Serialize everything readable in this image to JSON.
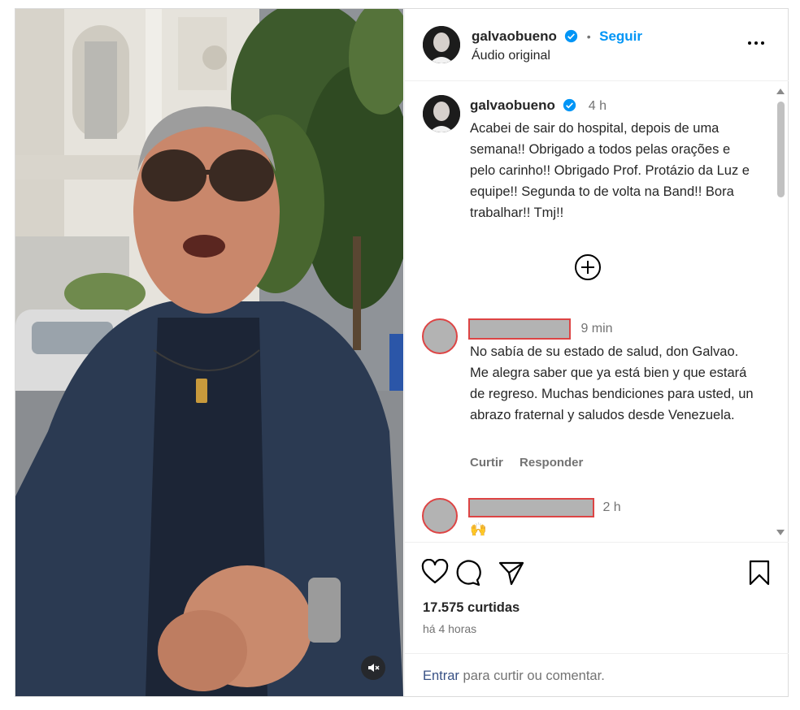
{
  "post": {
    "username": "galvaobueno",
    "follow_label": "Seguir",
    "separator": "•",
    "audio_label": "Áudio original"
  },
  "caption": {
    "username": "galvaobueno",
    "time": "4 h",
    "text": "Acabei de sair do hospital, depois de uma semana!! Obrigado a todos pelas orações e pelo carinho!! Obrigado Prof. Protázio da Luz e equipe!! Segunda to de volta na Band!! Bora trabalhar!! Tmj!!"
  },
  "comments": [
    {
      "time": "9 min",
      "text": "No sabía de su estado de salud, don Galvao. Me alegra saber que ya está bien y que estará de regreso. Muchas bendiciones para usted, un abrazo fraternal y saludos desde Venezuela.",
      "like_label": "Curtir",
      "reply_label": "Responder"
    },
    {
      "time": "2 h",
      "text": "🙌"
    }
  ],
  "stats": {
    "likes": "17.575 curtidas",
    "posted_ago": "há 4 horas"
  },
  "login_prompt": {
    "link": "Entrar",
    "text": "para curtir ou comentar."
  },
  "icons": {
    "verified": "verified-badge-icon",
    "more": "more-options-icon",
    "add": "plus-circle-icon",
    "like": "heart-icon",
    "comment": "comment-icon",
    "share": "send-icon",
    "save": "bookmark-icon",
    "mute": "muted-speaker-icon"
  },
  "colors": {
    "accent": "#0095f6",
    "link": "#385185",
    "redaction_border": "#dd4444"
  }
}
